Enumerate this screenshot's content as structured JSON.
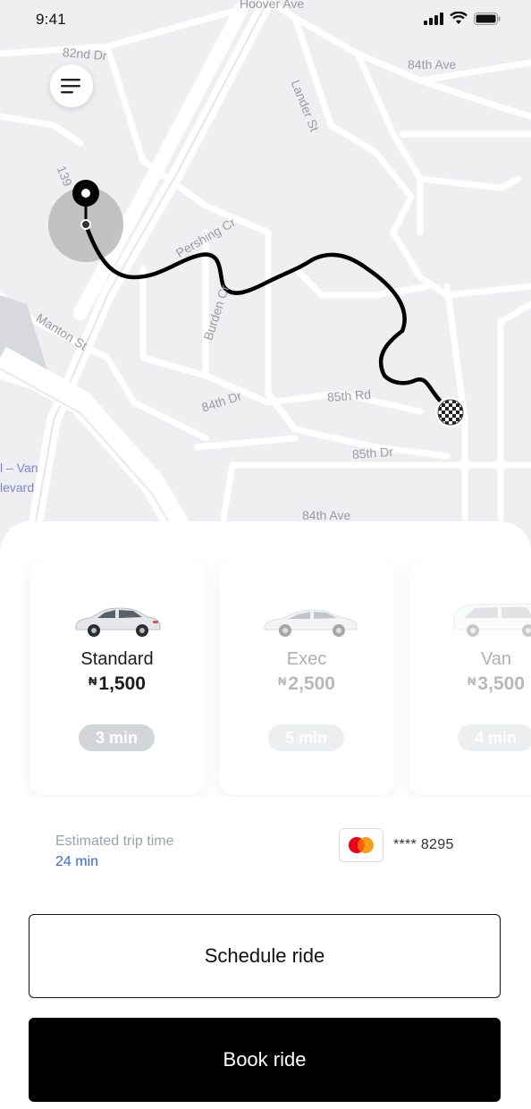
{
  "status_bar": {
    "time": "9:41"
  },
  "map": {
    "streets": {
      "hoover": "Hoover Ave",
      "s82nd": "82nd Dr",
      "s84th_ave": "84th Ave",
      "lander": "Lander St",
      "n139": "139",
      "pershing": "Pershing Cr",
      "burden": "Burden Cr",
      "manton": "Manton St",
      "s84th_dr": "84th Dr",
      "s85th_rd": "85th Rd",
      "s85th_dr": "85th Dr",
      "s84th_ave_bottom": "84th Ave"
    },
    "poi": {
      "line1": "l – Van",
      "line2": "levard"
    },
    "route_color": "#000000"
  },
  "rides": [
    {
      "name": "Standard",
      "currency": "₦",
      "price": "1,500",
      "eta": "3 min",
      "selected": true
    },
    {
      "name": "Exec",
      "currency": "₦",
      "price": "2,500",
      "eta": "5 min",
      "selected": false
    },
    {
      "name": "Van",
      "currency": "₦",
      "price": "3,500",
      "eta": "4 min",
      "selected": false
    }
  ],
  "trip": {
    "label": "Estimated trip time",
    "value": "24 min"
  },
  "payment": {
    "card_masked": "**** 8295",
    "brand": "mastercard-icon"
  },
  "actions": {
    "schedule_label": "Schedule ride",
    "book_label": "Book ride"
  },
  "colors": {
    "accent": "#3366e6",
    "primary": "#000000",
    "badge": "#d3d6d9"
  }
}
